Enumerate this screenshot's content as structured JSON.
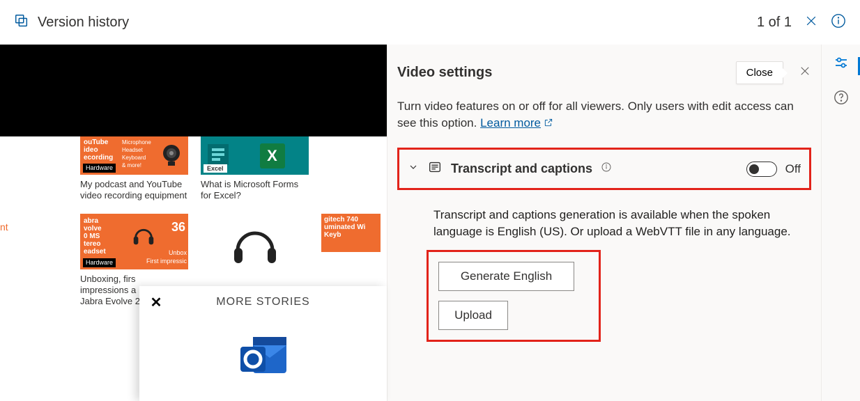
{
  "topbar": {
    "title": "Version history",
    "page_count": "1 of 1"
  },
  "preview": {
    "left_edge_text": "nt",
    "more_stories_label": "MORE STORIES",
    "cards": {
      "c1": {
        "thumb_left": "ouTube\nideo\necording",
        "thumb_right": "Microphone\nHeadset\nKeyboard\n& more!",
        "tag": "Hardware",
        "caption": "My podcast and YouTube video recording equipment"
      },
      "c2": {
        "excel_badge": "Excel",
        "caption": "What is Microsoft Forms for Excel?"
      },
      "c3": {
        "thumb_left": "abra\nvolve\n0 MS\ntereo\neadset",
        "tag": "Hardware",
        "num": "36",
        "unbox": "Unbox",
        "first": "First impressic",
        "caption": "Unboxing, firs\nimpressions a\nJabra Evolve 2"
      },
      "c4": {
        "thumb_text": "gitech 740\numinated Wi\nKeyb"
      }
    }
  },
  "panel": {
    "title": "Video settings",
    "close_label": "Close",
    "description_prefix": "Turn video features on or off for all viewers. Only users with edit access can see this option. ",
    "learn_more": "Learn more",
    "section": {
      "title": "Transcript and captions",
      "toggle_state": "Off",
      "sub_desc": "Transcript and captions generation is available when the spoken language is English (US). Or upload a WebVTT file in any language."
    },
    "buttons": {
      "generate": "Generate English",
      "upload": "Upload"
    }
  }
}
